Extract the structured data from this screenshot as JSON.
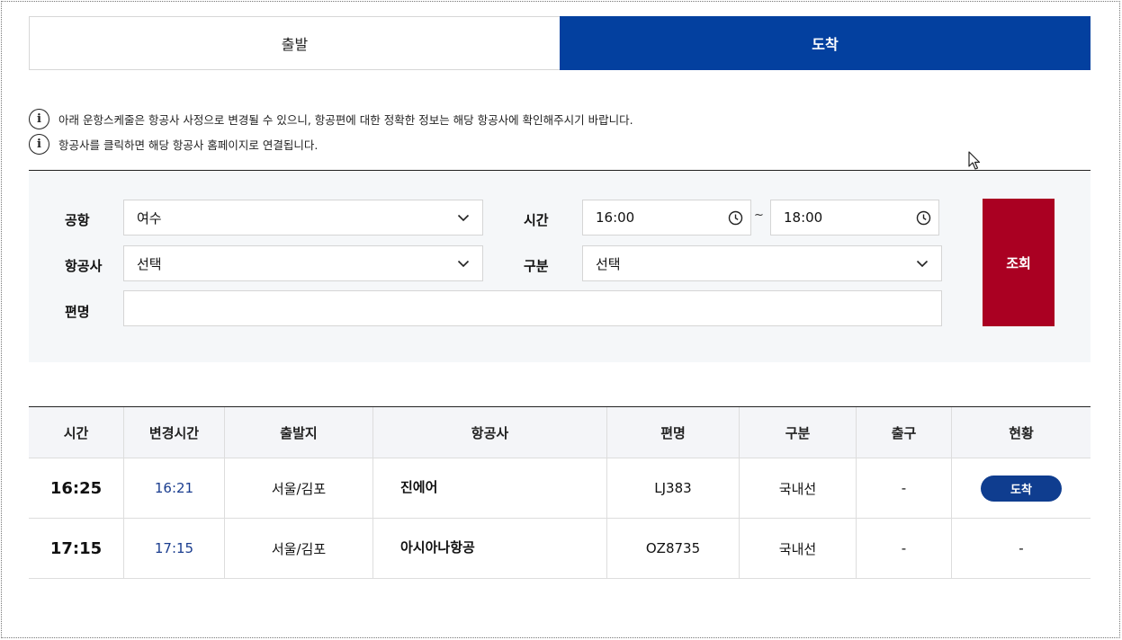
{
  "tabs": {
    "departure": "출발",
    "arrival": "도착",
    "active": "arrival"
  },
  "notices": [
    "아래 운항스케줄은 항공사 사정으로 변경될 수 있으니, 항공편에 대한 정확한 정보는 해당 항공사에 확인해주시기 바랍니다.",
    "항공사를 클릭하면 해당 항공사 홈페이지로 연결됩니다."
  ],
  "info_icon_glyph": "i",
  "search": {
    "airport_label": "공항",
    "airport_value": "여수",
    "time_label": "시간",
    "time_from": "16:00",
    "time_to": "18:00",
    "time_separator": "~",
    "airline_label": "항공사",
    "airline_value": "선택",
    "type_label": "구분",
    "type_value": "선택",
    "flight_label": "편명",
    "flight_value": "",
    "button_label": "조회"
  },
  "table": {
    "headers": [
      "시간",
      "변경시간",
      "출발지",
      "항공사",
      "편명",
      "구분",
      "출구",
      "현황"
    ],
    "rows": [
      {
        "time": "16:25",
        "changed": "16:21",
        "origin": "서울/김포",
        "airline": "진에어",
        "flight": "LJ383",
        "type": "국내선",
        "gate": "-",
        "status": "도착"
      },
      {
        "time": "17:15",
        "changed": "17:15",
        "origin": "서울/김포",
        "airline": "아시아나항공",
        "flight": "OZ8735",
        "type": "국내선",
        "gate": "-",
        "status": "-"
      }
    ]
  },
  "colors": {
    "tab_active": "#03409f",
    "search_button": "#aa0022",
    "status_badge": "#0f3d8f",
    "changed_time": "#1a3d8f"
  }
}
